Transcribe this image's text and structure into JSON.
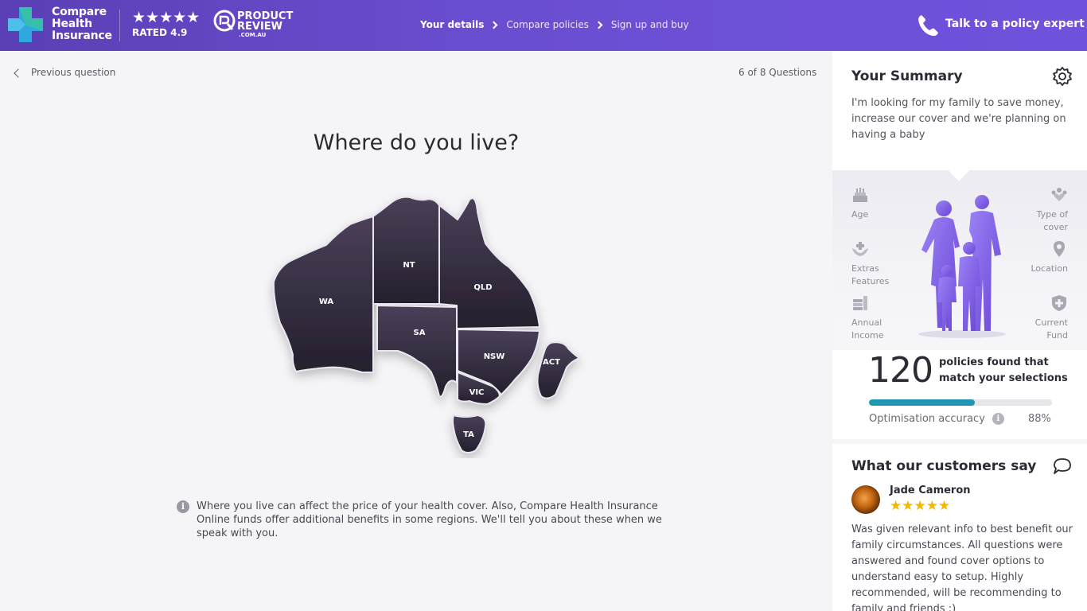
{
  "header": {
    "brand_lines": [
      "Compare",
      "Health",
      "Insurance"
    ],
    "stars": "★★★★★",
    "rating_label": "RATED 4.9",
    "productreview": {
      "line1": "PRODUCT",
      "line2": "REVIEW",
      "line3": ".COM.AU"
    },
    "steps": [
      {
        "label": "Your details",
        "active": true
      },
      {
        "label": "Compare policies",
        "active": false
      },
      {
        "label": "Sign up and buy",
        "active": false
      }
    ],
    "cta": "Talk to a policy expert",
    "colors": {
      "gradient_start": "#5b3fb5",
      "gradient_end": "#6f52dc",
      "logo_blue": "#2fa8e0",
      "logo_green": "#2fc08a"
    }
  },
  "main": {
    "previous_label": "Previous question",
    "question_count": "6 of 8 Questions",
    "question": "Where do you live?",
    "states": [
      "WA",
      "NT",
      "QLD",
      "SA",
      "NSW",
      "ACT",
      "VIC",
      "TA"
    ],
    "info_text": "Where you live can affect the price of your health cover. Also, Compare Health Insurance Online funds offer additional benefits in some regions. We'll tell you about these when we speak with you."
  },
  "summary": {
    "title": "Your Summary",
    "text": "I'm looking for my family to save money, increase our cover and we're planning on having a baby",
    "attributes": {
      "age": "Age",
      "type_of_cover": [
        "Type of",
        "cover"
      ],
      "extras": [
        "Extras",
        "Features"
      ],
      "location": "Location",
      "income": [
        "Annual",
        "Income"
      ],
      "current_fund": [
        "Current",
        "Fund"
      ]
    },
    "policies_count": "120",
    "policies_text": "policies found that match your selections",
    "accuracy_label": "Optimisation accuracy",
    "accuracy_value": "88%",
    "accuracy_bar_fraction": 0.58,
    "accent_color": "#2196b3"
  },
  "customers": {
    "title": "What our customers say",
    "reviewer": "Jade Cameron",
    "stars": "★★★★★",
    "review": "Was given relevant info to best benefit our family circumstances. All questions were answered and found cover options to understand easy to setup. Highly recommended, will be recommending to family and friends :)"
  }
}
